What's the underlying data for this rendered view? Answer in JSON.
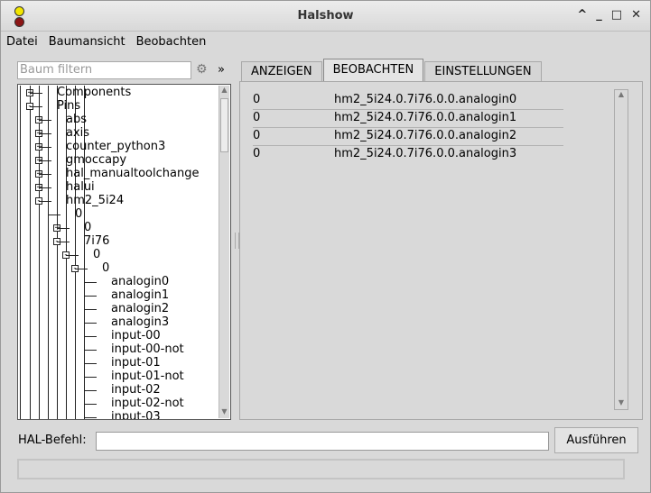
{
  "window": {
    "title": "Halshow"
  },
  "menubar": {
    "items": [
      "Datei",
      "Baumansicht",
      "Beobachten"
    ]
  },
  "filter": {
    "placeholder": "Baum filtern",
    "expand_label": "»"
  },
  "tree": {
    "items": [
      {
        "label": "Components",
        "depth": 0,
        "toggle": "+"
      },
      {
        "label": "Pins",
        "depth": 0,
        "toggle": "-"
      },
      {
        "label": "abs",
        "depth": 1,
        "toggle": "+"
      },
      {
        "label": "axis",
        "depth": 1,
        "toggle": "+"
      },
      {
        "label": "counter_python3",
        "depth": 1,
        "toggle": "+"
      },
      {
        "label": "gmoccapy",
        "depth": 1,
        "toggle": "+"
      },
      {
        "label": "hal_manualtoolchange",
        "depth": 1,
        "toggle": "+"
      },
      {
        "label": "halui",
        "depth": 1,
        "toggle": "+"
      },
      {
        "label": "hm2_5i24",
        "depth": 1,
        "toggle": "-"
      },
      {
        "label": "0",
        "depth": 2,
        "toggle": ""
      },
      {
        "label": "0",
        "depth": 3,
        "toggle": "+"
      },
      {
        "label": "7i76",
        "depth": 3,
        "toggle": "-"
      },
      {
        "label": "0",
        "depth": 4,
        "toggle": "-"
      },
      {
        "label": "0",
        "depth": 5,
        "toggle": "-"
      },
      {
        "label": "analogin0",
        "depth": 6,
        "toggle": ""
      },
      {
        "label": "analogin1",
        "depth": 6,
        "toggle": ""
      },
      {
        "label": "analogin2",
        "depth": 6,
        "toggle": ""
      },
      {
        "label": "analogin3",
        "depth": 6,
        "toggle": ""
      },
      {
        "label": "input-00",
        "depth": 6,
        "toggle": ""
      },
      {
        "label": "input-00-not",
        "depth": 6,
        "toggle": ""
      },
      {
        "label": "input-01",
        "depth": 6,
        "toggle": ""
      },
      {
        "label": "input-01-not",
        "depth": 6,
        "toggle": ""
      },
      {
        "label": "input-02",
        "depth": 6,
        "toggle": ""
      },
      {
        "label": "input-02-not",
        "depth": 6,
        "toggle": ""
      },
      {
        "label": "input-03",
        "depth": 6,
        "toggle": ""
      }
    ]
  },
  "tabs": [
    {
      "label": "ANZEIGEN",
      "active": false
    },
    {
      "label": "BEOBACHTEN",
      "active": true
    },
    {
      "label": "EINSTELLUNGEN",
      "active": false
    }
  ],
  "watch": {
    "rows": [
      {
        "value": "0",
        "name": "hm2_5i24.0.7i76.0.0.analogin0"
      },
      {
        "value": "0",
        "name": "hm2_5i24.0.7i76.0.0.analogin1"
      },
      {
        "value": "0",
        "name": "hm2_5i24.0.7i76.0.0.analogin2"
      },
      {
        "value": "0",
        "name": "hm2_5i24.0.7i76.0.0.analogin3"
      }
    ]
  },
  "command": {
    "label": "HAL-Befehl:",
    "value": "",
    "execute_label": "Ausführen"
  },
  "status": {
    "text": ""
  }
}
